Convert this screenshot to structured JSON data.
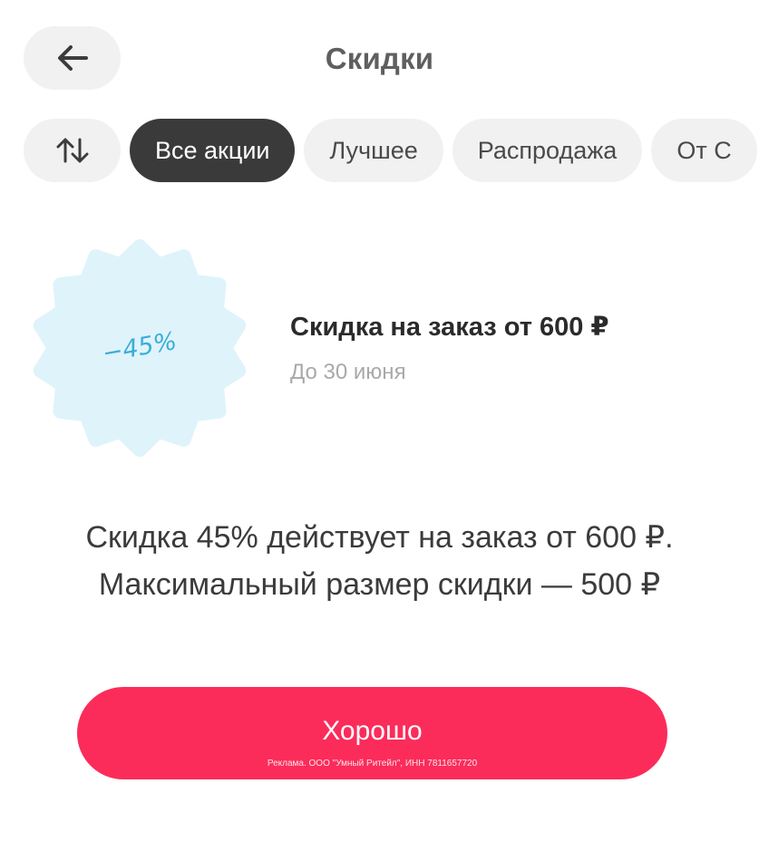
{
  "header": {
    "title": "Скидки",
    "back_icon": "arrow-left-icon"
  },
  "filters": {
    "sort_icon": "sort-arrows-icon",
    "chips": [
      "Все акции",
      "Лучшее",
      "Распродажа",
      "От С"
    ],
    "active_index": 0
  },
  "promo": {
    "badge_text": "−45%",
    "title": "Скидка на заказ от 600 ₽",
    "date": "До 30 июня"
  },
  "description": "Скидка 45% действует на заказ от 600 ₽. Максимальный размер скидки — 500 ₽",
  "button": {
    "label": "Хорошо",
    "ad_text": "Реклама. ООО \"Умный Ритейл\", ИНН 7811657720"
  },
  "colors": {
    "accent": "#fb2c5a",
    "chip_active": "#3a3a3a",
    "chip_inactive": "#f1f1f1",
    "badge_fill": "#dff3fb",
    "badge_text": "#3aaed6"
  }
}
